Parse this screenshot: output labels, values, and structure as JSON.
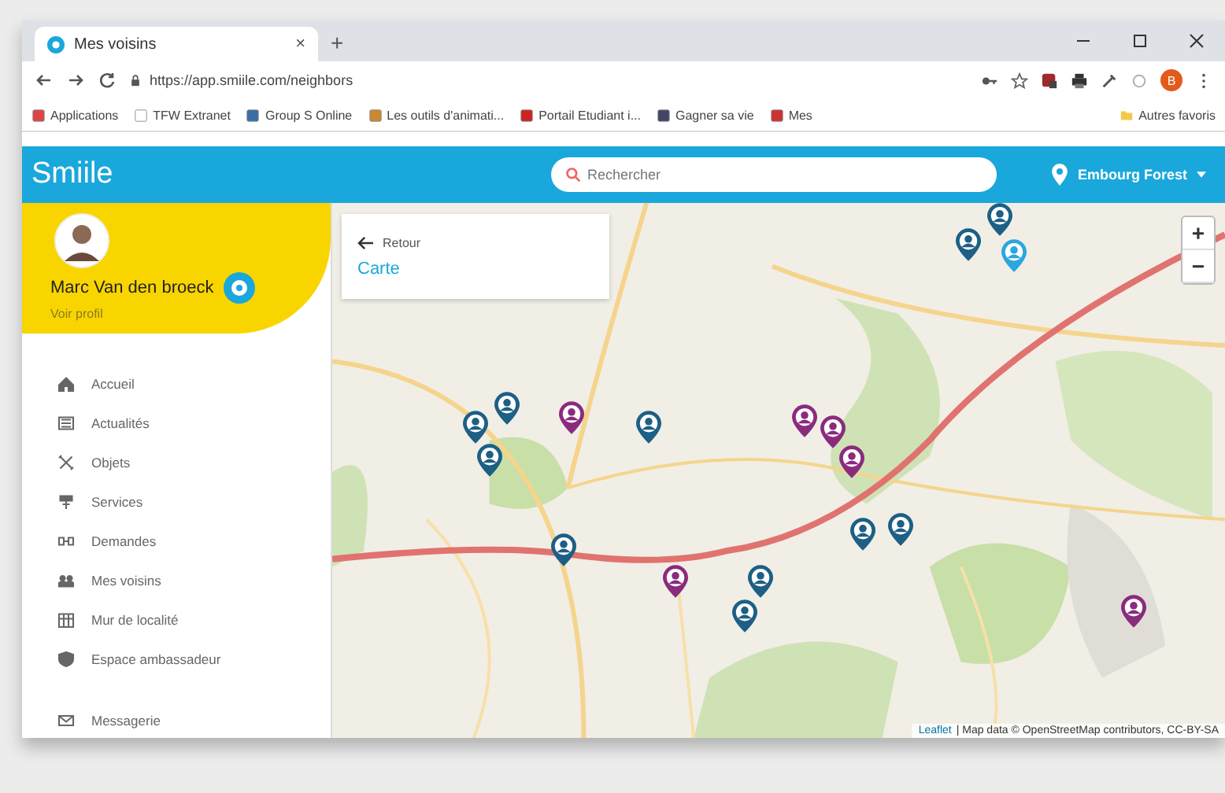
{
  "browser": {
    "tab_title": "Mes voisins",
    "tab_close": "×",
    "new_tab": "+",
    "url": "https://app.smiile.com/neighbors",
    "bookmarks": [
      "Applications",
      "TFW Extranet",
      "Group S Online",
      "Les outils d'animati...",
      "Portail Etudiant i...",
      "Gagner sa vie",
      "Mes"
    ],
    "other_bookmarks": "Autres favoris",
    "profile_initial": "B"
  },
  "app": {
    "logo": "Smiile",
    "search": {
      "placeholder": "Rechercher"
    },
    "location": "Embourg Forest"
  },
  "user": {
    "name": "Marc Van den broeck",
    "subtitle": "Voir profil"
  },
  "sidebar": {
    "items": [
      {
        "label": "Accueil"
      },
      {
        "label": "Actualités"
      },
      {
        "label": "Objets"
      },
      {
        "label": "Services"
      },
      {
        "label": "Demandes"
      },
      {
        "label": "Mes voisins"
      },
      {
        "label": "Mur de localité"
      },
      {
        "label": "Espace ambassadeur"
      },
      {
        "label": "Messagerie"
      }
    ]
  },
  "panel": {
    "back": "Retour",
    "title": "Carte"
  },
  "map": {
    "zoom_in": "+",
    "zoom_out": "−",
    "attribution_link": "Leaflet",
    "attribution": "| Map data © OpenStreetMap contributors, CC-BY-SA",
    "pins": [
      {
        "color": "#1d5f85"
      },
      {
        "color": "#1d5f85"
      },
      {
        "color": "#2aa7de"
      },
      {
        "color": "#1d5f85"
      },
      {
        "color": "#1d5f85"
      },
      {
        "color": "#1d5f85"
      },
      {
        "color": "#8a2b7e"
      },
      {
        "color": "#1d5f85"
      },
      {
        "color": "#8a2b7e"
      },
      {
        "color": "#8a2b7e"
      },
      {
        "color": "#8a2b7e"
      },
      {
        "color": "#1d5f85"
      },
      {
        "color": "#1d5f85"
      },
      {
        "color": "#1d5f85"
      },
      {
        "color": "#8a2b7e"
      },
      {
        "color": "#1d5f85"
      },
      {
        "color": "#1d5f85"
      },
      {
        "color": "#8a2b7e"
      }
    ]
  }
}
